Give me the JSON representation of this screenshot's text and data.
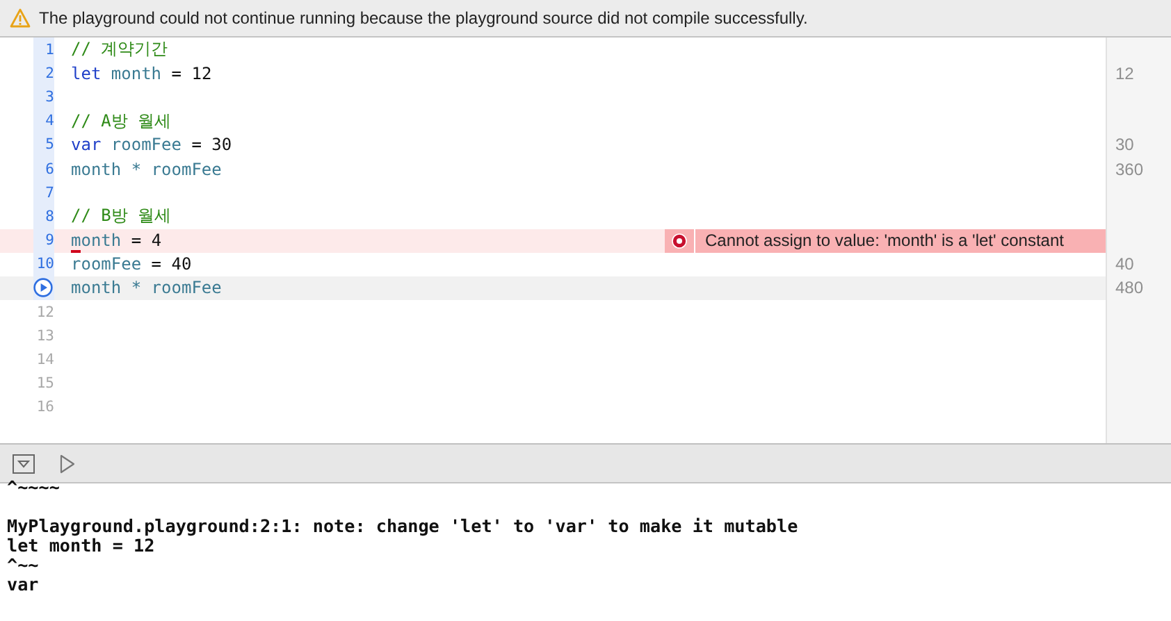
{
  "banner": {
    "message": "The playground could not continue running because the playground source did not compile successfully."
  },
  "editor": {
    "lines": [
      {
        "number": "1",
        "executed": true,
        "kind": "normal",
        "tokens": [
          {
            "kind": "comment",
            "text": "// 계약기간"
          }
        ]
      },
      {
        "number": "2",
        "executed": true,
        "kind": "normal",
        "tokens": [
          {
            "kind": "keyword",
            "text": "let"
          },
          {
            "kind": "identifier",
            "text": " month"
          },
          {
            "kind": "plain",
            "text": " = 12"
          }
        ],
        "result": "12"
      },
      {
        "number": "3",
        "executed": true,
        "kind": "normal"
      },
      {
        "number": "4",
        "executed": true,
        "kind": "normal",
        "tokens": [
          {
            "kind": "comment",
            "text": "// A방 월세"
          }
        ]
      },
      {
        "number": "5",
        "executed": true,
        "kind": "normal",
        "tokens": [
          {
            "kind": "keyword",
            "text": "var"
          },
          {
            "kind": "identifier",
            "text": " roomFee"
          },
          {
            "kind": "plain",
            "text": " = 30"
          }
        ],
        "result": "30"
      },
      {
        "number": "6",
        "executed": true,
        "kind": "normal",
        "tokens": [
          {
            "kind": "identifier",
            "text": "month * roomFee"
          }
        ],
        "result": "360"
      },
      {
        "number": "7",
        "executed": true,
        "kind": "normal"
      },
      {
        "number": "8",
        "executed": true,
        "kind": "normal",
        "tokens": [
          {
            "kind": "comment",
            "text": "// B방 월세"
          }
        ]
      },
      {
        "number": "9",
        "executed": true,
        "kind": "error",
        "tokens": [
          {
            "kind": "identifier",
            "text": "m",
            "underline": true
          },
          {
            "kind": "identifier",
            "text": "onth"
          },
          {
            "kind": "plain",
            "text": " = 4"
          }
        ],
        "error": "Cannot assign to value: 'month' is a 'let' constant"
      },
      {
        "number": "10",
        "executed": true,
        "kind": "normal",
        "tokens": [
          {
            "kind": "identifier",
            "text": "roomFee"
          },
          {
            "kind": "plain",
            "text": " = 40"
          }
        ],
        "result": "40"
      },
      {
        "executed": true,
        "kind": "current",
        "run_marker": true,
        "tokens": [
          {
            "kind": "identifier",
            "text": "month * roomFee"
          }
        ],
        "result": "480"
      },
      {
        "number": "12",
        "executed": false,
        "kind": "normal"
      },
      {
        "number": "13",
        "executed": false,
        "kind": "normal"
      },
      {
        "number": "14",
        "executed": false,
        "kind": "normal"
      },
      {
        "number": "15",
        "executed": false,
        "kind": "normal"
      },
      {
        "number": "16",
        "executed": false,
        "kind": "normal"
      }
    ]
  },
  "console": {
    "blocks": [
      [
        "^~~~~"
      ],
      [
        "MyPlayground.playground:2:1: note: change 'let' to 'var' to make it mutable",
        "let month = 12",
        "^~~",
        "var"
      ]
    ]
  }
}
